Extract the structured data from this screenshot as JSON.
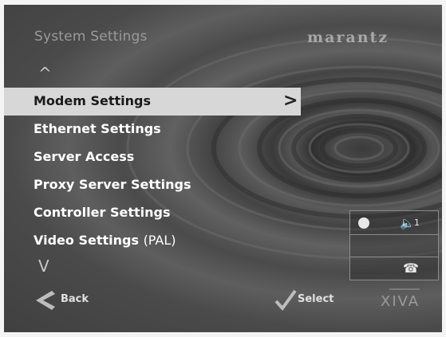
{
  "header": {
    "title": "System Settings",
    "brand": "marantz"
  },
  "nav": {
    "up_arrow": "^",
    "down_arrow": "V"
  },
  "menu": {
    "items": [
      {
        "label": "Modem Settings",
        "selected": true
      },
      {
        "label": "Ethernet Settings",
        "selected": false
      },
      {
        "label": "Server Access",
        "selected": false
      },
      {
        "label": "Proxy Server Settings",
        "selected": false
      },
      {
        "label": "Controller Settings",
        "selected": false
      },
      {
        "label": "Video Settings",
        "suffix": "(PAL)",
        "selected": false
      }
    ],
    "selected_chevron": ">"
  },
  "status_panel": {
    "dot_icon": "status-dot-icon",
    "speaker_icon": "speaker-icon",
    "speaker_number": "1",
    "phone_icon": "phone-icon"
  },
  "footer": {
    "back_label": "Back",
    "select_label": "Select",
    "logo": "XIVA"
  },
  "colors": {
    "selected_bg": "#d7d7d7",
    "text": "#ffffff",
    "dim_text": "#9a9a9a"
  }
}
